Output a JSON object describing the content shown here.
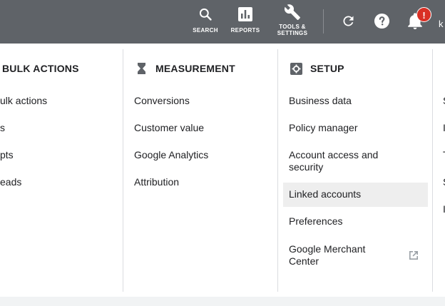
{
  "topbar": {
    "search_label": "SEARCH",
    "reports_label": "REPORTS",
    "tools_label": "TOOLS &\nSETTINGS",
    "notification_badge": "!",
    "user_initial": "k",
    "bg_color": "#5f6368",
    "badge_color": "#d93025"
  },
  "menu": {
    "bulk_actions": {
      "heading": "BULK ACTIONS",
      "items": [
        "ulk actions",
        "s",
        "pts",
        "eads"
      ]
    },
    "measurement": {
      "heading": "MEASUREMENT",
      "items": [
        "Conversions",
        "Customer value",
        "Google Analytics",
        "Attribution"
      ]
    },
    "setup": {
      "heading": "SETUP",
      "items": [
        "Business data",
        "Policy manager",
        "Account access and security",
        "Linked accounts",
        "Preferences",
        "Google Merchant Center"
      ],
      "active_item": "Linked accounts"
    },
    "partial_right": {
      "items": [
        "S",
        "I",
        "T",
        "S",
        "I"
      ]
    }
  }
}
